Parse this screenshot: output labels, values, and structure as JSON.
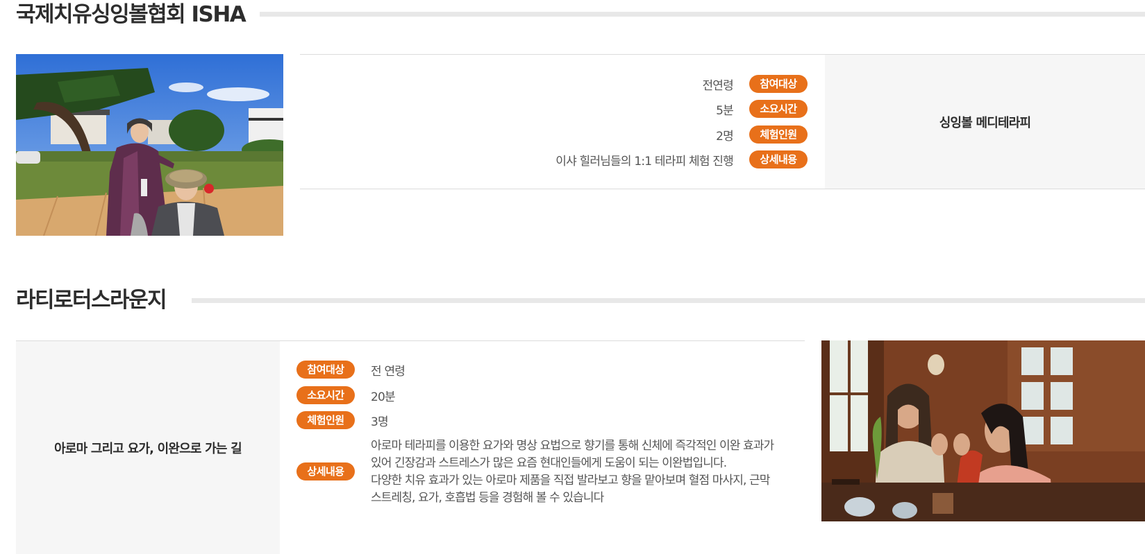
{
  "sections": [
    {
      "title": "국제치유싱잉볼협회 ISHA",
      "program_name": "싱잉볼 메디테라피",
      "rows": [
        {
          "label": "참여대상",
          "value": "전연령"
        },
        {
          "label": "소요시간",
          "value": "5분"
        },
        {
          "label": "체험인원",
          "value": "2명"
        },
        {
          "label": "상세내용",
          "value": "이샤 힐러님들의 1:1 테라피 체험 진행"
        }
      ]
    },
    {
      "title": "라티로터스라운지",
      "program_name": "아로마 그리고 요가, 이완으로 가는 길",
      "rows": [
        {
          "label": "참여대상",
          "value": "전 연령"
        },
        {
          "label": "소요시간",
          "value": "20분"
        },
        {
          "label": "체험인원",
          "value": "3명"
        },
        {
          "label": "상세내용",
          "value": ""
        }
      ],
      "detail_lines": [
        "아로마 테라피를 이용한 요가와 명상 요법으로 향기를 통해 신체에 즉각적인 이완 효과가",
        "있어 긴장감과 스트레스가 많은 요즘 현대인들에게 도움이 되는 이완법입니다.",
        "다양한 치유 효과가 있는 아로마 제품을 직접 발라보고 향을 맡아보며 혈점 마사지, 근막",
        "스트레칭, 요가, 호흡법 등을 경험해 볼 수 있습니다"
      ]
    }
  ],
  "colors": {
    "badge": "#e8701a",
    "panel": "#f6f6f6",
    "rule": "#e8e8e8"
  }
}
